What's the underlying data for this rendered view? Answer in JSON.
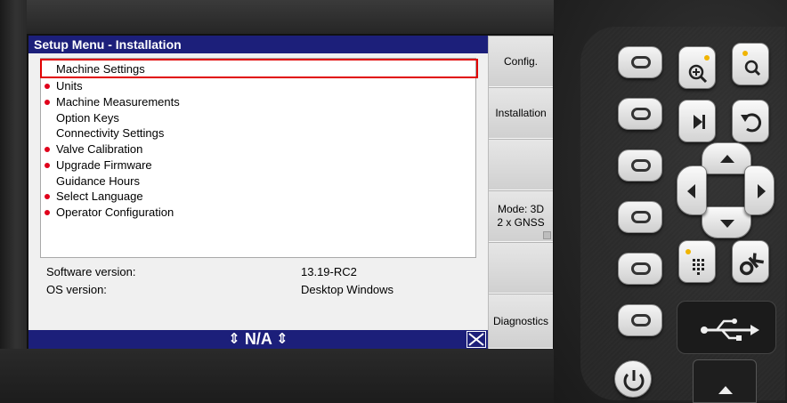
{
  "screen": {
    "title": "Setup Menu - Installation",
    "menu_items": [
      {
        "label": "Machine Settings",
        "dot": false,
        "selected": true
      },
      {
        "label": "Units",
        "dot": true,
        "selected": false
      },
      {
        "label": "Machine Measurements",
        "dot": true,
        "selected": false
      },
      {
        "label": "Option Keys",
        "dot": false,
        "selected": false
      },
      {
        "label": "Connectivity Settings",
        "dot": false,
        "selected": false
      },
      {
        "label": "Valve Calibration",
        "dot": true,
        "selected": false
      },
      {
        "label": "Upgrade Firmware",
        "dot": true,
        "selected": false
      },
      {
        "label": "Guidance Hours",
        "dot": false,
        "selected": false
      },
      {
        "label": "Select Language",
        "dot": true,
        "selected": false
      },
      {
        "label": "Operator Configuration",
        "dot": true,
        "selected": false
      }
    ],
    "info": {
      "software_label": "Software version:",
      "software_value": "13.19-RC2",
      "os_label": "OS version:",
      "os_value": "Desktop Windows"
    },
    "status": {
      "text": "N/A"
    },
    "soft_keys": {
      "config": "Config.",
      "installation": "Installation",
      "blank1": "",
      "mode_line1": "Mode: 3D",
      "mode_line2": "2 x GNSS",
      "blank2": "",
      "diagnostics": "Diagnostics"
    }
  },
  "colors": {
    "title_bar": "#1c1f7a",
    "selection_border": "#e10000",
    "bullet": "#e0001b"
  },
  "icons": {
    "zoom_in": "zoom-in-icon",
    "zoom": "zoom-icon",
    "skip": "skip-next-icon",
    "undo": "undo-icon",
    "keypad": "keypad-icon",
    "ok": "ok-icon",
    "usb": "usb-icon",
    "power": "power-icon",
    "eject": "eject-icon"
  }
}
